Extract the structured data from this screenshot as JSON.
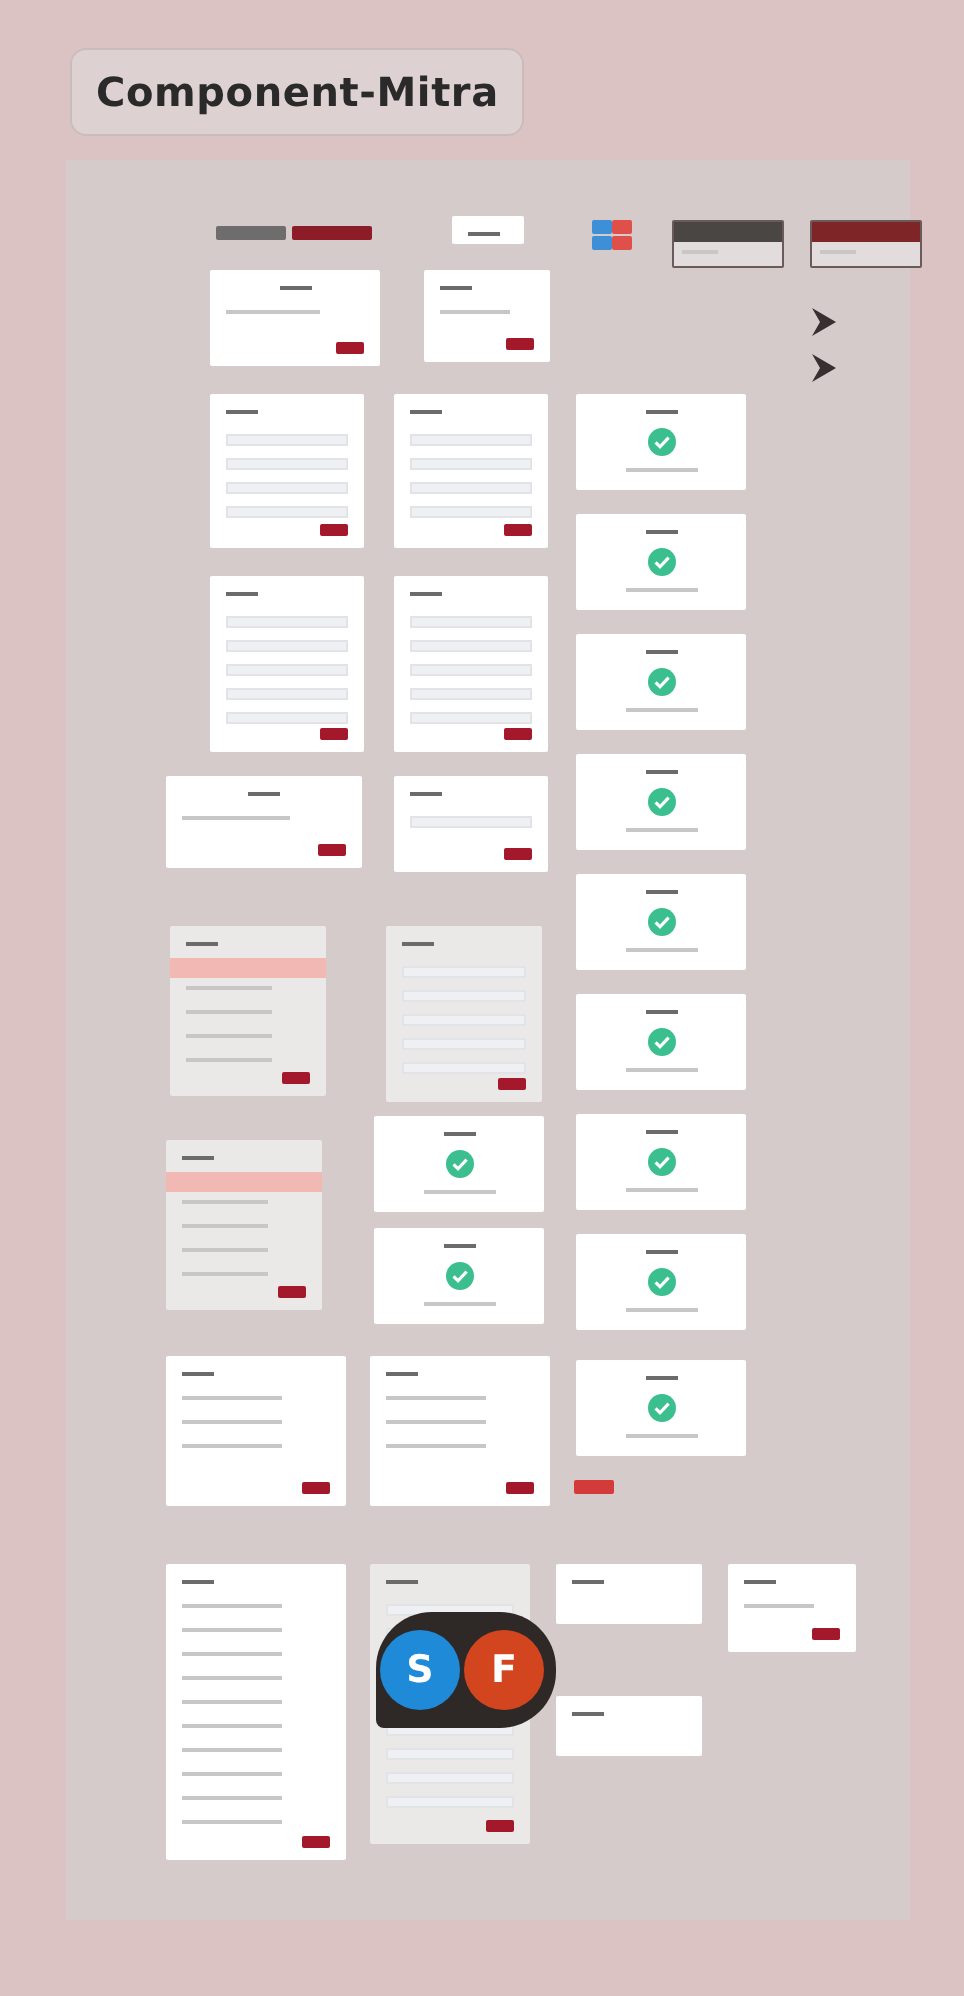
{
  "page_title": "Component-Mitra",
  "collaborators": [
    {
      "letter": "S",
      "color": "#1f8ad8"
    },
    {
      "letter": "F",
      "color": "#d3451f"
    }
  ]
}
